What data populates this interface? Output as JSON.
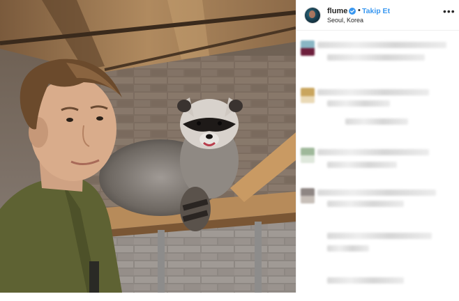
{
  "post": {
    "username": "flume",
    "follow_label": "Takip Et",
    "separator": "•",
    "location": "Seoul, Korea",
    "more_label": "•••",
    "verified": true,
    "image_description": "selfie with raccoon on shelf",
    "accent_color": "#3897f0"
  },
  "comments": [
    {
      "avatar_colors": [
        "#8ab6c4",
        "#6d1f3c"
      ]
    },
    {
      "avatar_colors": [
        "#c9a55e",
        "#ead9b6"
      ]
    },
    {
      "avatar_colors": [
        "#9fb89a",
        "#dfe8dc"
      ]
    },
    {
      "avatar_colors": [
        "#8e8683",
        "#c7bfb8"
      ]
    }
  ]
}
